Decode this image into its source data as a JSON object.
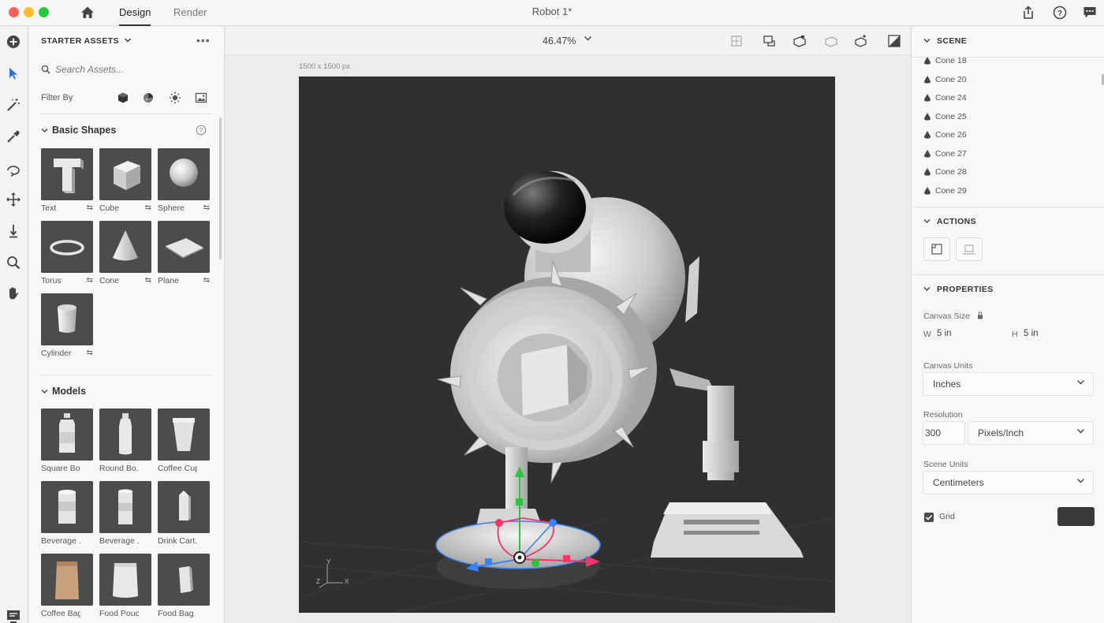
{
  "titlebar": {
    "tabs": [
      "Design",
      "Render"
    ],
    "document_title": "Robot 1*"
  },
  "assets_panel": {
    "header": "STARTER ASSETS",
    "more": "•••",
    "search_placeholder": "Search Assets...",
    "filter_label": "Filter By",
    "sections": [
      {
        "title": "Basic Shapes",
        "items": [
          "Text",
          "Cube",
          "Sphere",
          "Torus",
          "Cone",
          "Plane",
          "Cylinder"
        ]
      },
      {
        "title": "Models",
        "items": [
          "Square Bo...",
          "Round Bo...",
          "Coffee Cup",
          "Beverage ...",
          "Beverage ...",
          "Drink Cart...",
          "Coffee Bag",
          "Food Pouch",
          "Food Bag"
        ]
      }
    ]
  },
  "canvas": {
    "zoom": "46.47%",
    "size_label": "1500 x 1500 px",
    "axis_labels": {
      "y": "Y",
      "x": "X",
      "z": "Z"
    }
  },
  "right_panel": {
    "scene": {
      "title": "SCENE",
      "items": [
        "Cone 18",
        "Cone 20",
        "Cone 24",
        "Cone 25",
        "Cone 26",
        "Cone 27",
        "Cone 28",
        "Cone 29"
      ]
    },
    "actions": {
      "title": "ACTIONS"
    },
    "properties": {
      "title": "PROPERTIES",
      "canvas_size_label": "Canvas Size",
      "width_label": "W",
      "width_value": "5 in",
      "height_label": "H",
      "height_value": "5 in",
      "canvas_units_label": "Canvas Units",
      "canvas_units_value": "Inches",
      "resolution_label": "Resolution",
      "resolution_value": "300",
      "resolution_unit": "Pixels/Inch",
      "scene_units_label": "Scene Units",
      "scene_units_value": "Centimeters",
      "grid_label": "Grid",
      "grid_checked": true,
      "grid_color": "#3a3a3a"
    }
  },
  "colors": {
    "viewport_bg": "#303030",
    "active_tool": "#2d74da",
    "gizmo_y": "#2fc23b",
    "gizmo_x": "#f0386b",
    "gizmo_z": "#3b82f0"
  }
}
